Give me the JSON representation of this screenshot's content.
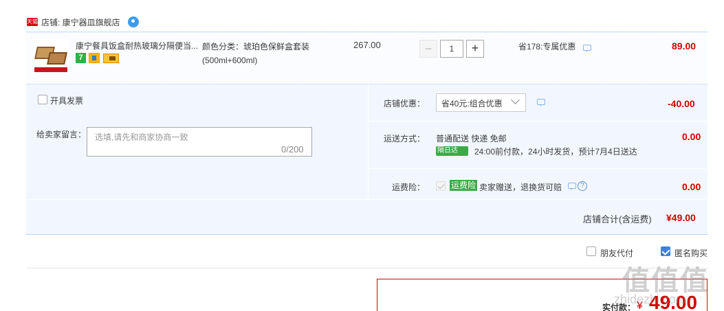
{
  "shop": {
    "badge": "天猫",
    "name": "店铺: 康宁器皿旗舰店"
  },
  "item": {
    "title": "康宁餐具饭盒耐热玻璃分隔便当...",
    "badge_seven": "7",
    "sku": "颜色分类：琥珀色保鲜盒套装(500ml+600ml)",
    "unit_price": "267.00",
    "qty_minus": "−",
    "quantity": "1",
    "qty_plus": "+",
    "promo": "省178:专属优惠",
    "total": "89.00"
  },
  "invoice": {
    "label": "开具发票",
    "checked": false
  },
  "memo": {
    "label": "给卖家留言：",
    "placeholder": "选填,请先和商家协商一致",
    "count": "0/200"
  },
  "shop_discount": {
    "label": "店铺优惠：",
    "selected": "省40元:组合优惠",
    "amount": "-40.00"
  },
  "shipping": {
    "label": "运送方式：",
    "method": "普通配送 快递 免邮",
    "next_day_tag": "隔日达",
    "note": "24:00前付款，24小时发货，预计7月4日送达",
    "amount": "0.00"
  },
  "insurance": {
    "label": "运费险：",
    "tag": "运费险",
    "desc": "卖家赠送，退换货可赔",
    "help": "?",
    "amount": "0.00"
  },
  "subtotal": {
    "label": "店铺合计(含运费)",
    "amount": "¥49.00"
  },
  "options": {
    "friend_pay": "朋友代付",
    "anonymous": "匿名购买"
  },
  "payment": {
    "label": "实付款：",
    "currency": "¥",
    "amount": "49.00"
  },
  "watermark": {
    "text": "值值值",
    "url": "zhidezhi.com"
  },
  "colors": {
    "accent_red": "#d20000",
    "link_blue": "#3d7fe3",
    "tag_green": "#3bab48",
    "panel_bg": "#f2f7ff"
  }
}
